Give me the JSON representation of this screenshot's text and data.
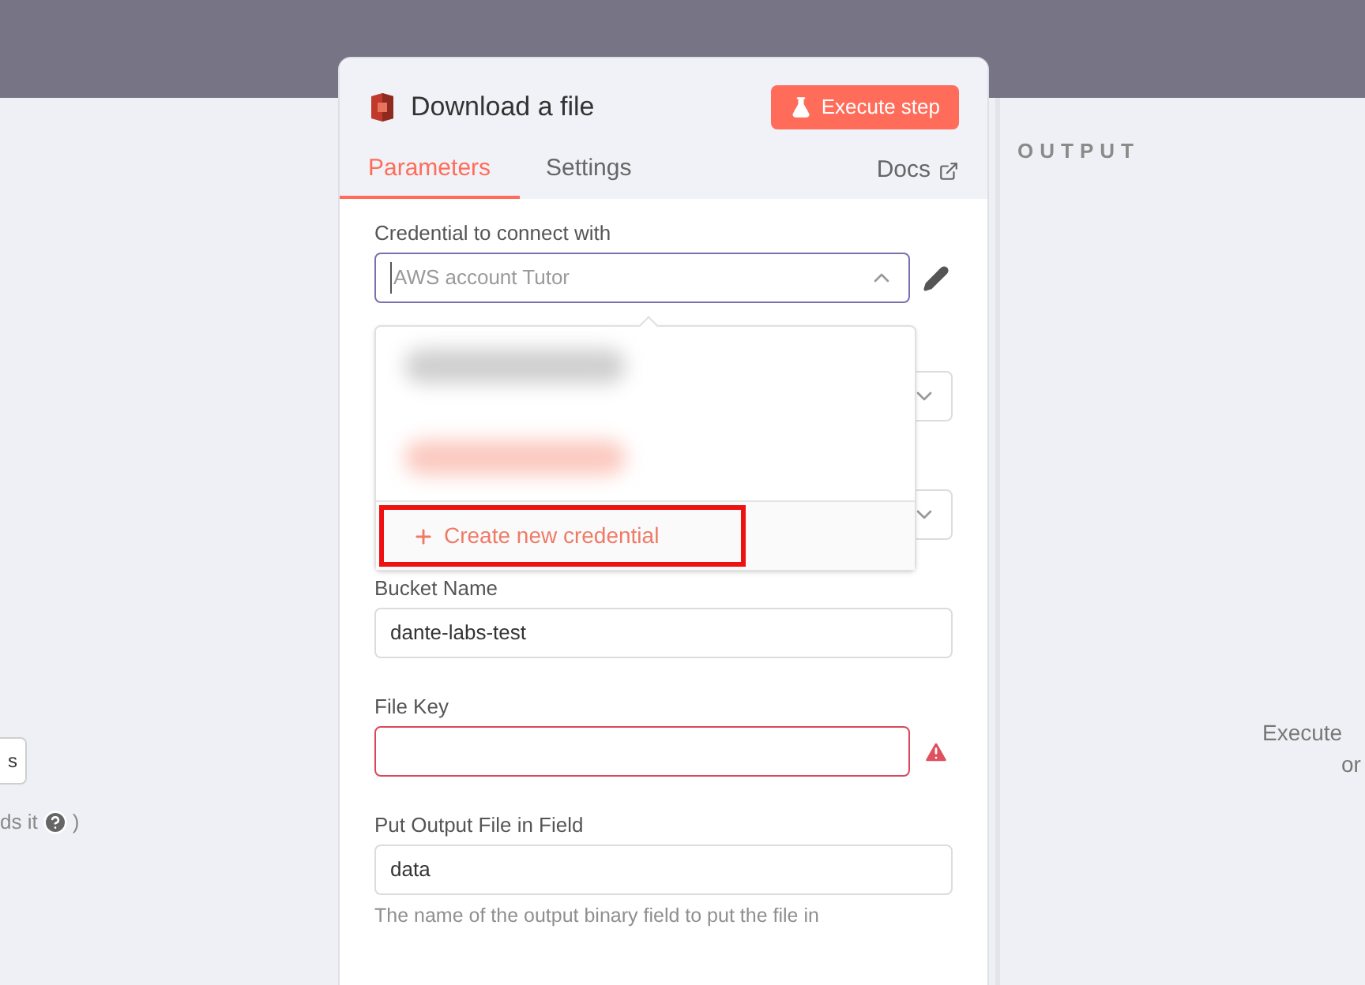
{
  "left_panel": {
    "button_label": "s",
    "hint": "ds it",
    "hint_close": ")"
  },
  "node": {
    "title": "Download a file",
    "execute_button": "Execute step",
    "tabs": [
      {
        "label": "Parameters",
        "selected": true
      },
      {
        "label": "Settings",
        "selected": false
      }
    ],
    "docs_link": "Docs",
    "fields": [
      {
        "kind": "credential",
        "label": "Credential to connect with",
        "placeholder": "AWS account Tutor",
        "focused": true
      },
      {
        "kind": "select"
      },
      {
        "kind": "select"
      },
      {
        "kind": "text",
        "label": "Bucket Name",
        "value": "dante-labs-test",
        "error": false
      },
      {
        "kind": "text",
        "label": "File Key",
        "error": true
      },
      {
        "kind": "text",
        "label": "Put Output File in Field",
        "value": "data",
        "error": false,
        "hint": "The name of the output binary field to put the file in"
      }
    ],
    "dropdown": {
      "action": "Create new credential",
      "highlighted": true
    }
  },
  "output_panel": {
    "title": "OUTPUT",
    "message_lines": [
      "Execute",
      "or"
    ]
  }
}
